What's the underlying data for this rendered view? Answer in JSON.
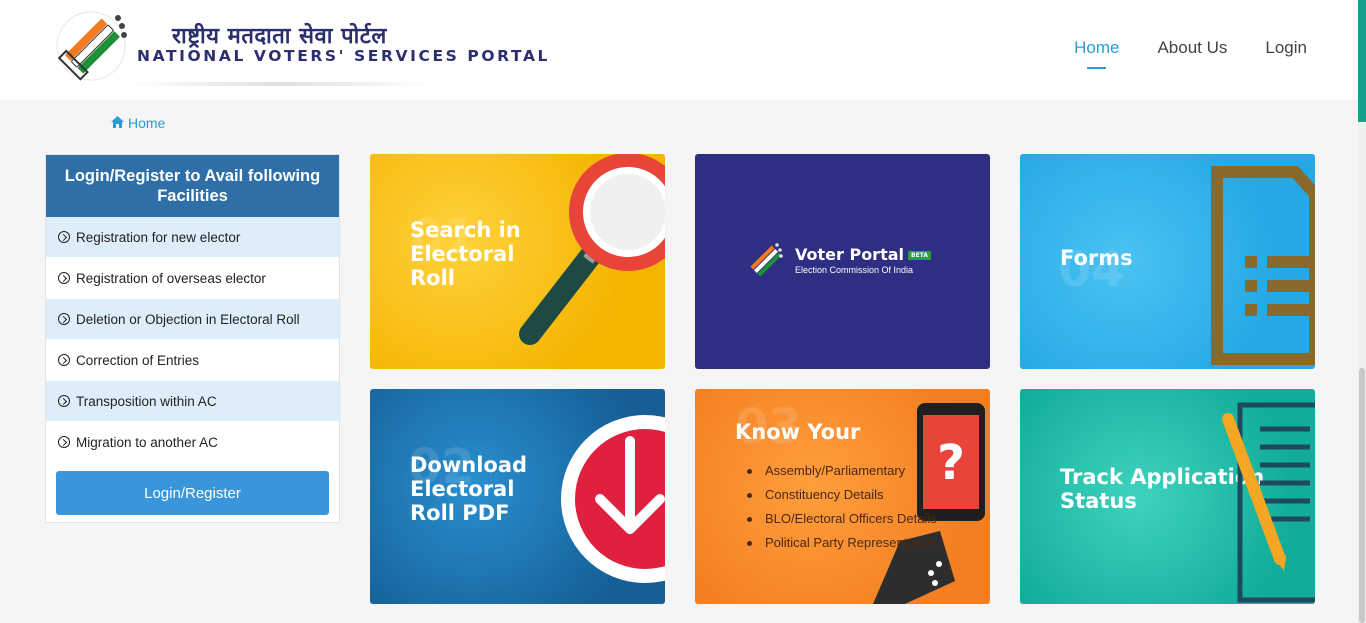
{
  "header": {
    "logo_hindi": "राष्ट्रीय मतदाता सेवा पोर्टल",
    "logo_english": "NATIONAL VOTERS' SERVICES PORTAL",
    "nav": [
      {
        "label": "Home",
        "active": true
      },
      {
        "label": "About Us",
        "active": false
      },
      {
        "label": "Login",
        "active": false
      }
    ]
  },
  "breadcrumb": {
    "label": "Home",
    "icon": "home-icon"
  },
  "panel": {
    "title": "Login/Register to Avail following Facilities",
    "items": [
      "Registration for new elector",
      "Registration of overseas elector",
      "Deletion or Objection in Electoral Roll",
      "Correction of Entries",
      "Transposition within AC",
      "Migration to another AC"
    ],
    "button_label": "Login/Register"
  },
  "tiles": {
    "search": {
      "title_line1": "Search in",
      "title_line2": "Electoral",
      "title_line3": "Roll",
      "icon": "magnifier-icon"
    },
    "voter_portal": {
      "title": "Voter Portal",
      "badge": "BETA",
      "subtitle": "Election Commission Of India"
    },
    "forms": {
      "title": "Forms",
      "icon": "document-icon"
    },
    "download": {
      "title_line1": "Download",
      "title_line2": "Electoral",
      "title_line3": "Roll PDF",
      "icon": "download-icon"
    },
    "know_your": {
      "title": "Know Your",
      "items": [
        "Assembly/Parliamentary",
        "Constituency Details",
        "BLO/Electoral Officers Details",
        "Political Party Representative"
      ],
      "icon": "phone-question-icon"
    },
    "track": {
      "title_line1": "Track Application",
      "title_line2": "Status",
      "icon": "clipboard-pencil-icon"
    }
  },
  "colors": {
    "primary_blue": "#2a9bd6",
    "panel_header": "#2e6fa8",
    "button_blue": "#3a96da",
    "search_tile": "#f4b400",
    "voter_portal_tile": "#2e2f82",
    "forms_tile": "#25a8e6",
    "download_tile": "#155f96",
    "know_your_tile": "#f37f22",
    "track_tile": "#11ad99"
  }
}
